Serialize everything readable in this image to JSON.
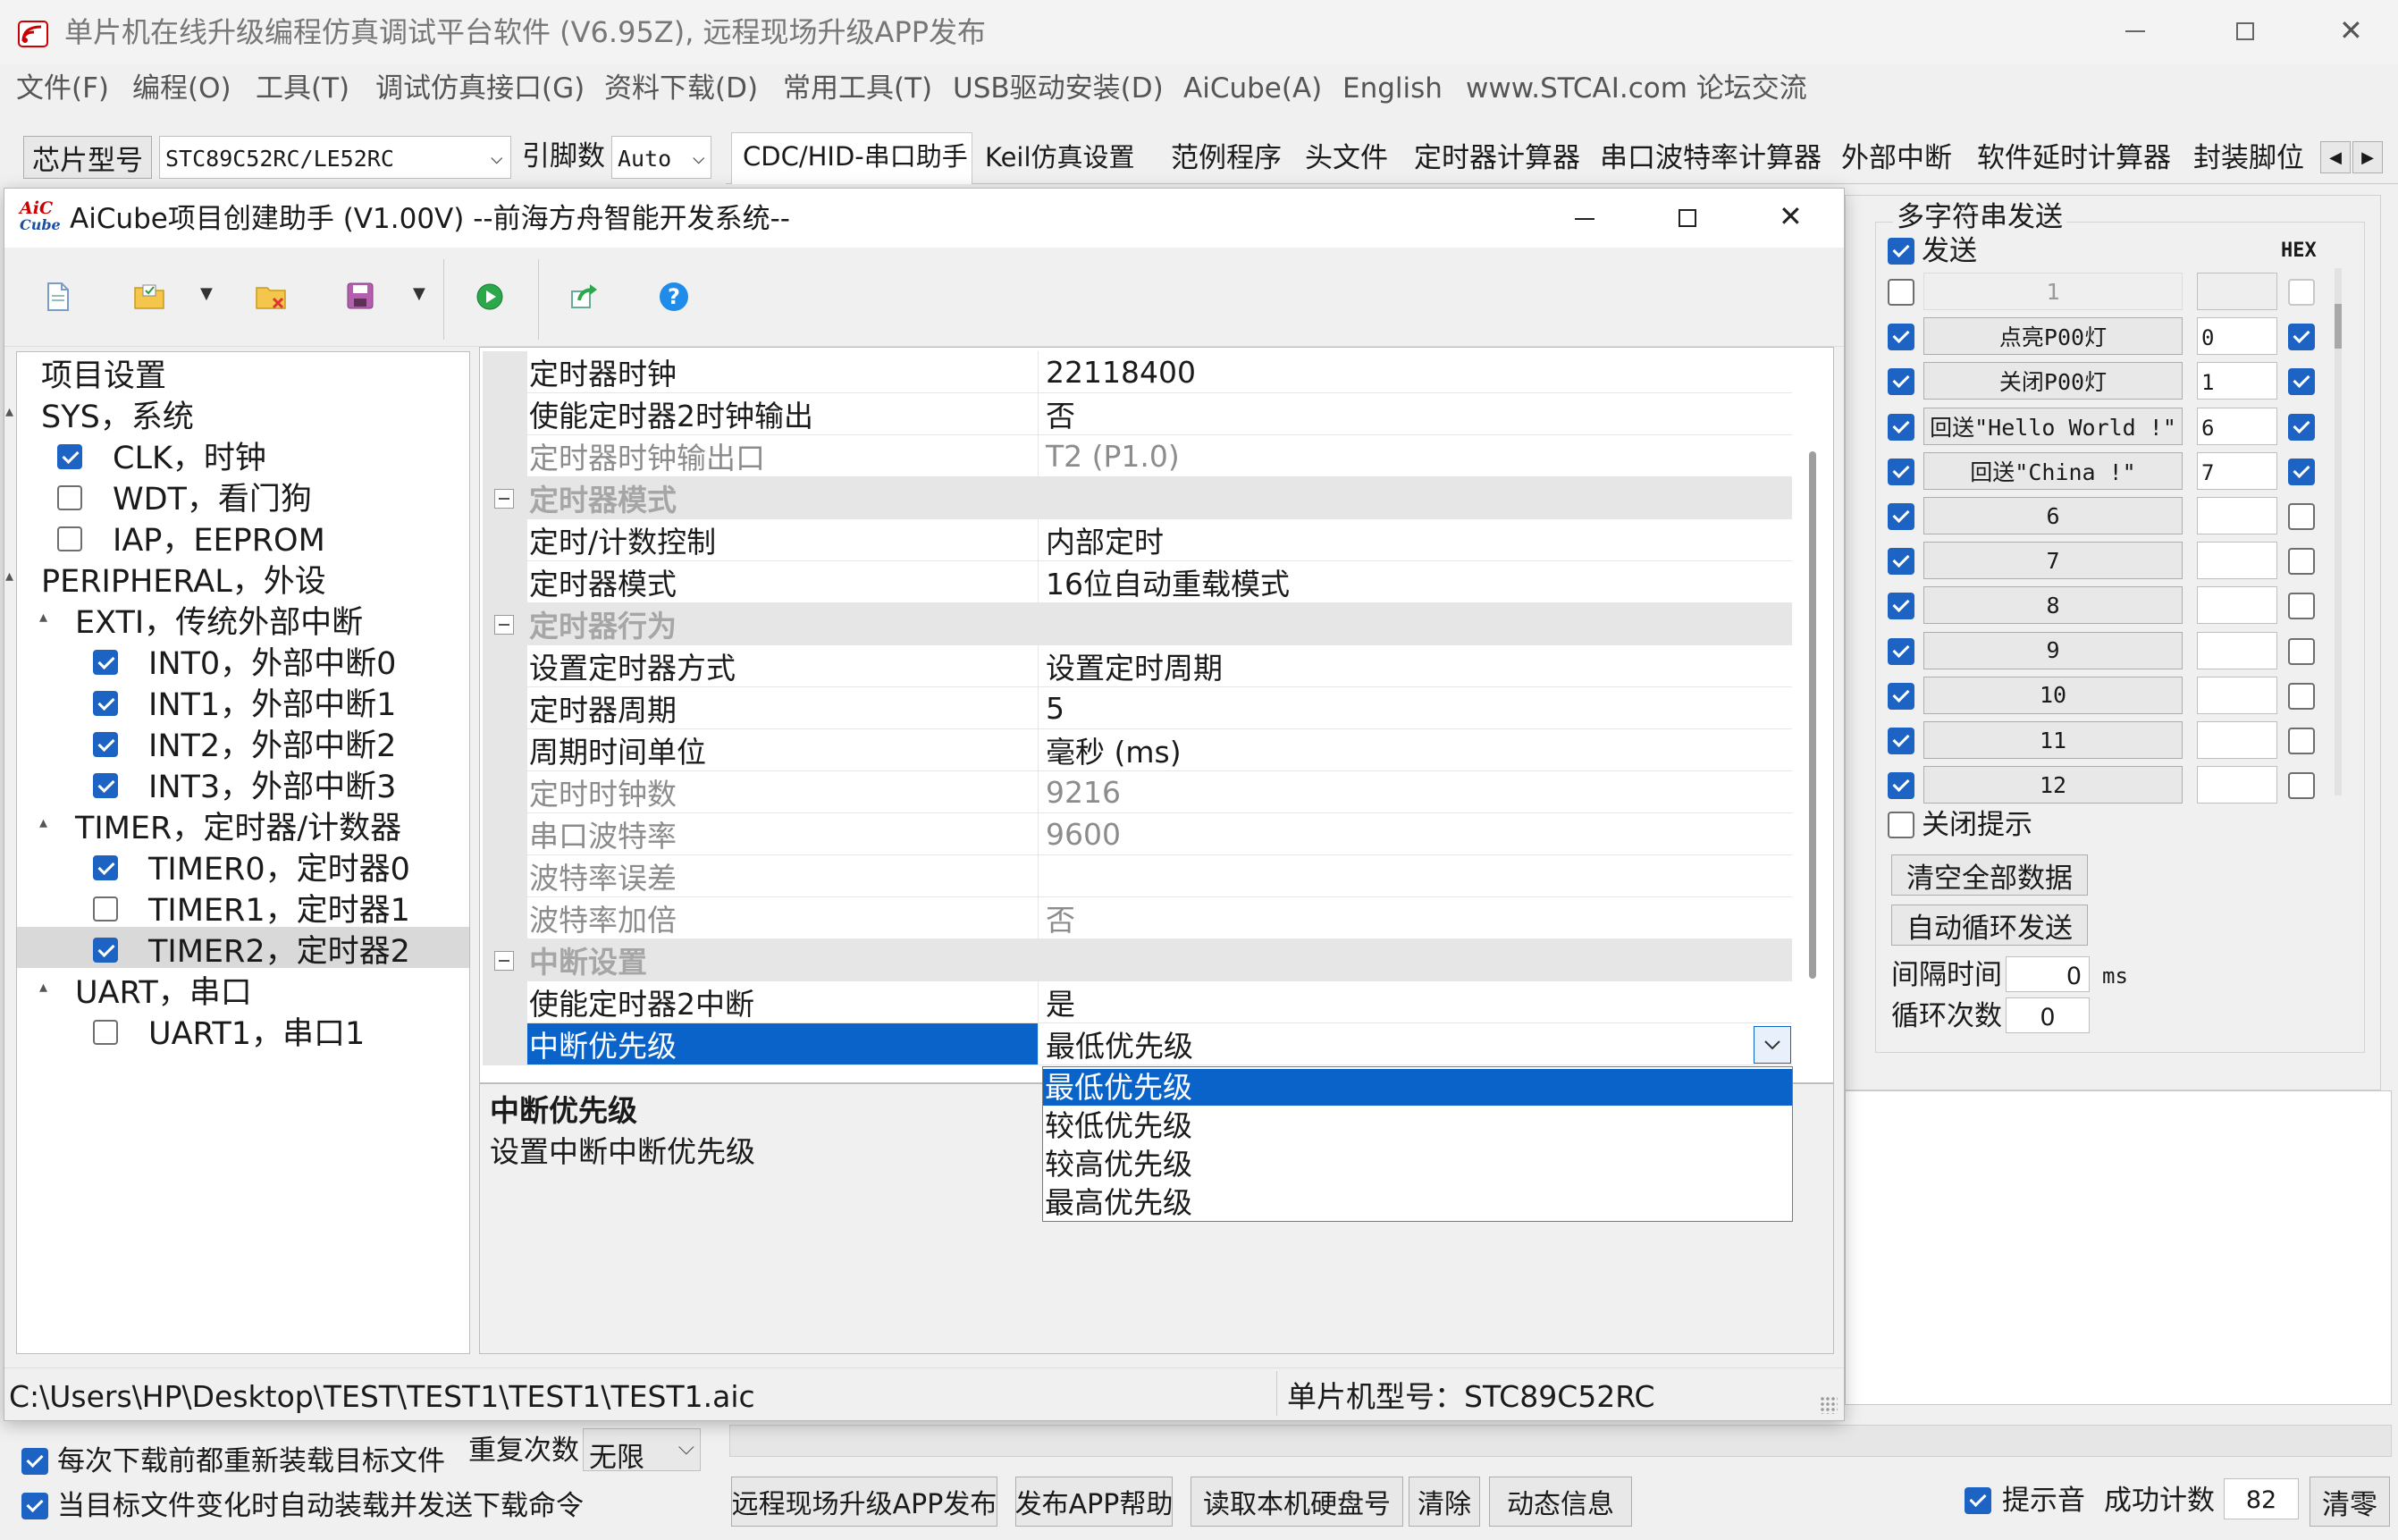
{
  "main_window": {
    "title": "单片机在线升级编程仿真调试平台软件 (V6.95Z), 远程现场升级APP发布",
    "menu": [
      "文件(F)",
      "编程(O)",
      "工具(T)",
      "调试仿真接口(G)",
      "资料下载(D)",
      "常用工具(T)",
      "USB驱动安装(D)",
      "AiCube(A)",
      "English",
      "www.STCAI.com 论坛交流"
    ],
    "chip_label": "芯片型号",
    "chip_value": "STC89C52RC/LE52RC",
    "pin_label": "引脚数",
    "pin_value": "Auto",
    "tabs": [
      "CDC/HID-串口助手",
      "Keil仿真设置",
      "范例程序",
      "头文件",
      "定时器计算器",
      "串口波特率计算器",
      "外部中断",
      "软件延时计算器",
      "封装脚位"
    ]
  },
  "dialog": {
    "title": "AiCube项目创建助手 (V1.00V) --前海方舟智能开发系统--",
    "toolbar_icons": [
      "new-file-icon",
      "open-folder-icon",
      "close-folder-icon",
      "save-icon",
      "run-icon",
      "export-icon",
      "help-icon"
    ],
    "tree": [
      {
        "label": "项目设置",
        "level": 0,
        "checkbox": null
      },
      {
        "label": "SYS，系统",
        "level": 0,
        "checkbox": null
      },
      {
        "label": "CLK，时钟",
        "level": 1,
        "checkbox": true
      },
      {
        "label": "WDT，看门狗",
        "level": 1,
        "checkbox": false
      },
      {
        "label": "IAP，EEPROM",
        "level": 1,
        "checkbox": false
      },
      {
        "label": "PERIPHERAL，外设",
        "level": 0,
        "checkbox": null
      },
      {
        "label": "EXTI，传统外部中断",
        "level": 1,
        "checkbox": null
      },
      {
        "label": "INT0，外部中断0",
        "level": 2,
        "checkbox": true
      },
      {
        "label": "INT1，外部中断1",
        "level": 2,
        "checkbox": true
      },
      {
        "label": "INT2，外部中断2",
        "level": 2,
        "checkbox": true
      },
      {
        "label": "INT3，外部中断3",
        "level": 2,
        "checkbox": true
      },
      {
        "label": "TIMER，定时器/计数器",
        "level": 1,
        "checkbox": null
      },
      {
        "label": "TIMER0，定时器0",
        "level": 2,
        "checkbox": true
      },
      {
        "label": "TIMER1，定时器1",
        "level": 2,
        "checkbox": false
      },
      {
        "label": "TIMER2，定时器2",
        "level": 2,
        "checkbox": true,
        "selected": true
      },
      {
        "label": "UART，串口",
        "level": 1,
        "checkbox": null
      },
      {
        "label": "UART1，串口1",
        "level": 2,
        "checkbox": false
      }
    ],
    "properties": [
      {
        "type": "prop",
        "key": "定时器时钟",
        "value": "22118400"
      },
      {
        "type": "prop",
        "key": "使能定时器2时钟输出",
        "value": "否"
      },
      {
        "type": "prop",
        "key": "定时器时钟输出口",
        "value": "T2 (P1.0)",
        "disabled": true
      },
      {
        "type": "cat",
        "key": "定时器模式"
      },
      {
        "type": "prop",
        "key": "定时/计数控制",
        "value": "内部定时"
      },
      {
        "type": "prop",
        "key": "定时器模式",
        "value": "16位自动重载模式"
      },
      {
        "type": "cat",
        "key": "定时器行为"
      },
      {
        "type": "prop",
        "key": "设置定时器方式",
        "value": "设置定时周期"
      },
      {
        "type": "prop",
        "key": "定时器周期",
        "value": "5"
      },
      {
        "type": "prop",
        "key": "周期时间单位",
        "value": "毫秒 (ms)"
      },
      {
        "type": "prop",
        "key": "定时时钟数",
        "value": "9216",
        "disabled": true
      },
      {
        "type": "prop",
        "key": "串口波特率",
        "value": "9600",
        "disabled": true
      },
      {
        "type": "prop",
        "key": "波特率误差",
        "value": "",
        "disabled": true
      },
      {
        "type": "prop",
        "key": "波特率加倍",
        "value": "否",
        "disabled": true
      },
      {
        "type": "cat",
        "key": "中断设置"
      },
      {
        "type": "prop",
        "key": "使能定时器2中断",
        "value": "是"
      },
      {
        "type": "prop",
        "key": "中断优先级",
        "value": "最低优先级",
        "selected": true
      }
    ],
    "dropdown_options": [
      "最低优先级",
      "较低优先级",
      "较高优先级",
      "最高优先级"
    ],
    "dropdown_selected": "最低优先级",
    "desc_title": "中断优先级",
    "desc_text": "设置中断中断优先级",
    "status_path": "C:\\Users\\HP\\Desktop\\TEST\\TEST1\\TEST1\\TEST1.aic",
    "status_chip": "单片机型号：STC89C52RC"
  },
  "right_panel": {
    "group_title": "多字符串发送",
    "send_label": "发送",
    "hex_label": "HEX",
    "rows": [
      {
        "checked": false,
        "label": "1",
        "value": "",
        "hex": false,
        "disabled": true
      },
      {
        "checked": true,
        "label": "点亮P00灯",
        "value": "0",
        "hex": true
      },
      {
        "checked": true,
        "label": "关闭P00灯",
        "value": "1",
        "hex": true
      },
      {
        "checked": true,
        "label": "回送\"Hello World !\"",
        "value": "6",
        "hex": true
      },
      {
        "checked": true,
        "label": "回送\"China !\"",
        "value": "7",
        "hex": true
      },
      {
        "checked": true,
        "label": "6",
        "value": "",
        "hex": false
      },
      {
        "checked": true,
        "label": "7",
        "value": "",
        "hex": false
      },
      {
        "checked": true,
        "label": "8",
        "value": "",
        "hex": false
      },
      {
        "checked": true,
        "label": "9",
        "value": "",
        "hex": false
      },
      {
        "checked": true,
        "label": "10",
        "value": "",
        "hex": false
      },
      {
        "checked": true,
        "label": "11",
        "value": "",
        "hex": false
      },
      {
        "checked": true,
        "label": "12",
        "value": "",
        "hex": false
      }
    ],
    "close_tip": "关闭提示",
    "clear_all": "清空全部数据",
    "auto_loop": "自动循环发送",
    "interval_label": "间隔时间",
    "interval_value": "0",
    "interval_unit": "ms",
    "loop_label": "循环次数",
    "loop_value": "0"
  },
  "bottom": {
    "reload_before_download": "每次下载前都重新装载目标文件",
    "auto_reload_on_change": "当目标文件变化时自动装载并发送下载命令",
    "repeat_label": "重复次数",
    "repeat_value": "无限",
    "buttons": [
      "远程现场升级APP发布",
      "发布APP帮助",
      "读取本机硬盘号",
      "清除",
      "动态信息"
    ],
    "beep_label": "提示音",
    "success_label": "成功计数",
    "success_value": "82",
    "clear_count": "清零"
  }
}
